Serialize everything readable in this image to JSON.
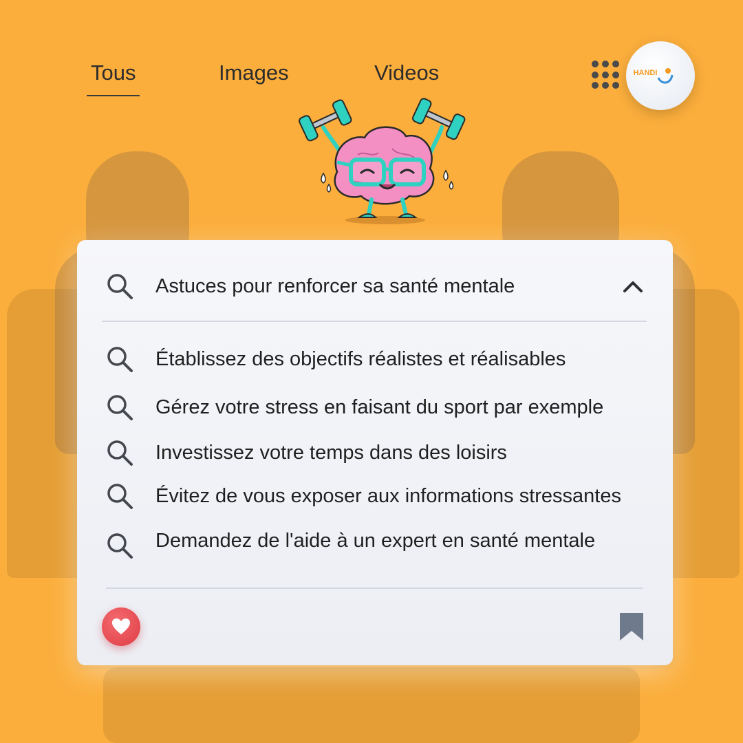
{
  "nav": {
    "tabs": [
      {
        "label": "Tous",
        "active": true
      },
      {
        "label": "Images",
        "active": false
      },
      {
        "label": "Videos",
        "active": false
      }
    ],
    "apps_icon": "grid-icon",
    "logo_text": "HANDI"
  },
  "search": {
    "query": "Astuces pour renforcer sa santé mentale",
    "suggestions": [
      "Établissez des objectifs réalistes et réalisables",
      "Gérez votre stress en faisant du sport par exemple",
      "Investissez votre temps dans des loisirs",
      "Évitez de vous exposer aux informations stressantes",
      "Demandez de l'aide à un expert en santé mentale"
    ]
  },
  "actions": {
    "like_icon": "heart-icon",
    "save_icon": "bookmark-icon"
  },
  "colors": {
    "background": "#FBAE3C",
    "card": "#F2F4F8",
    "heart": "#E4454D",
    "bookmark": "#6F7B8C",
    "brain": "#F48FC4",
    "accent_teal": "#2FD1C1"
  }
}
